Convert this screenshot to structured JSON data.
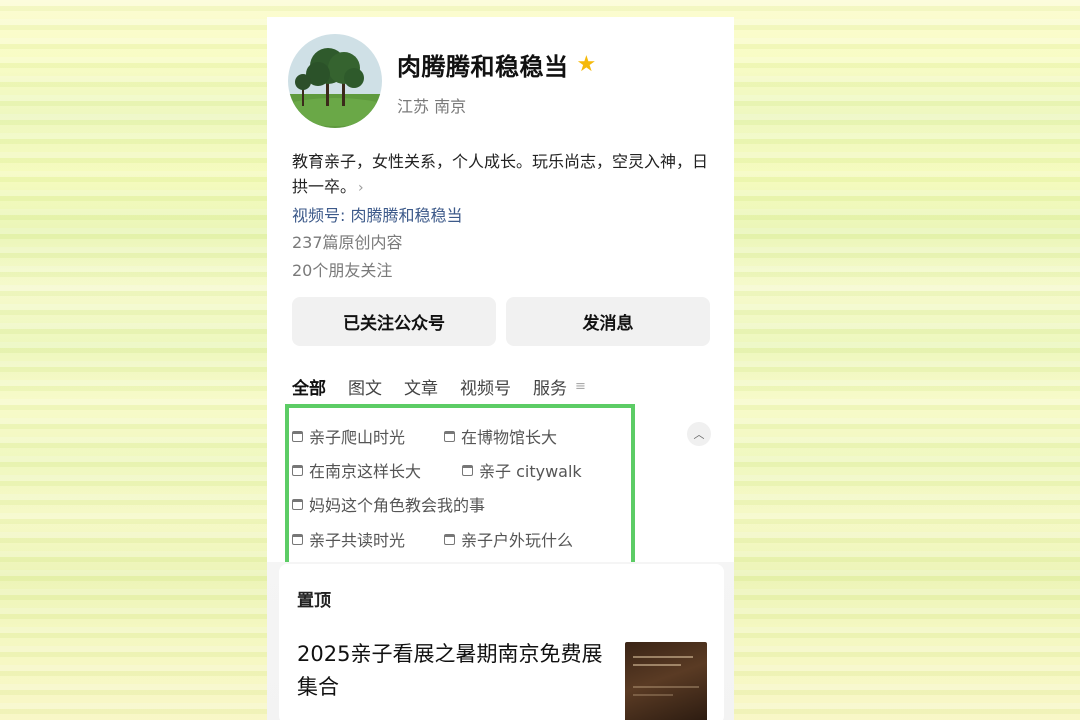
{
  "profile": {
    "name": "肉腾腾和稳稳当",
    "location": "江苏 南京",
    "bio": "教育亲子，女性关系，个人成长。玩乐尚志，空灵入神，日拱一卒。",
    "video_account": "视频号: 肉腾腾和稳稳当",
    "original_count": "237篇原创内容",
    "friends_following": "20个朋友关注"
  },
  "buttons": {
    "follow": "已关注公众号",
    "message": "发消息"
  },
  "tabs": [
    {
      "label": "全部",
      "active": true
    },
    {
      "label": "图文",
      "active": false
    },
    {
      "label": "文章",
      "active": false
    },
    {
      "label": "视频号",
      "active": false
    },
    {
      "label": "服务",
      "active": false
    }
  ],
  "collections": [
    "亲子爬山时光",
    "在博物馆长大",
    "在南京这样长大",
    "亲子 citywalk",
    "妈妈这个角色教会我的事",
    "亲子共读时光",
    "亲子户外玩什么"
  ],
  "pinned": {
    "label": "置顶",
    "article_title": "2025亲子看展之暑期南京免费展集合"
  },
  "colors": {
    "highlight_border": "#5ccc65",
    "link": "#3d5a8a",
    "star": "#f5b90a"
  },
  "icons": {
    "verified": "star-icon",
    "collection": "folder-icon",
    "collapse": "chevron-up-icon",
    "tab_menu": "menu-icon",
    "bio_more": "chevron-right-icon"
  }
}
